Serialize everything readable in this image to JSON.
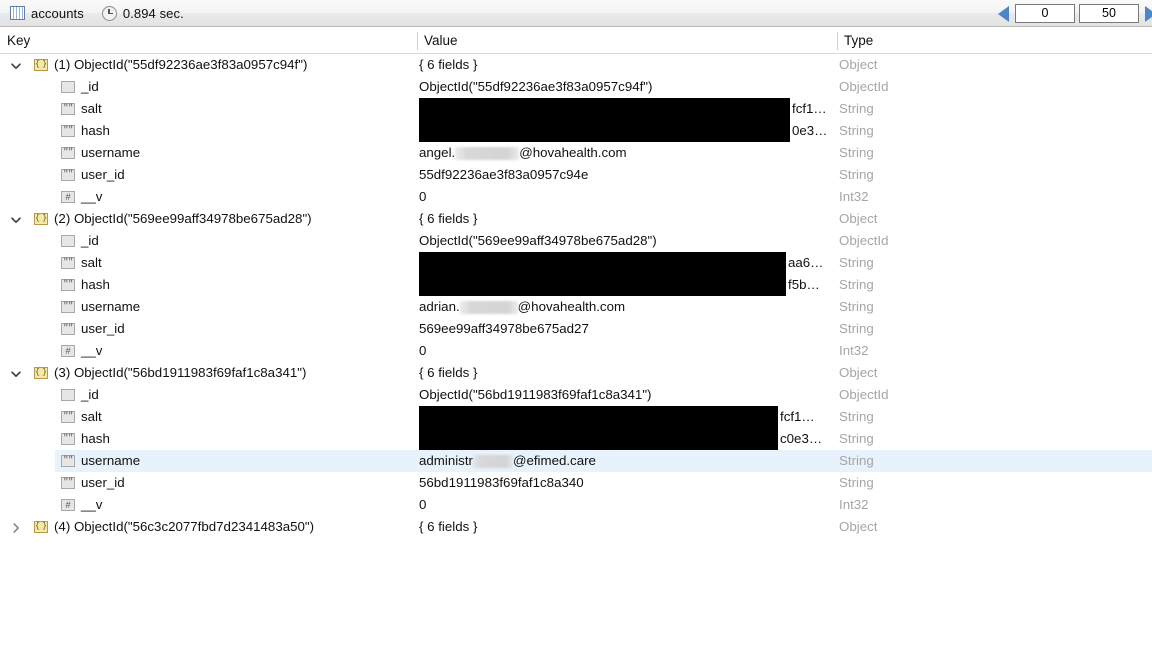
{
  "toolbar": {
    "collection_icon": "grid-icon",
    "collection_name": "accounts",
    "timer_icon": "clock-icon",
    "query_time": "0.894 sec.",
    "prev_icon": "left-arrow-icon",
    "next_icon": "right-arrow-icon",
    "skip_value": "0",
    "limit_value": "50"
  },
  "columns": {
    "key": "Key",
    "value": "Value",
    "type": "Type"
  },
  "rows": [
    {
      "indent": 0,
      "twisty": "expanded",
      "icon": "object-icon",
      "key": "(1) ObjectId(\"55df92236ae3f83a0957c94f\")",
      "value": "{ 6 fields }",
      "type": "Object"
    },
    {
      "indent": 1,
      "twisty": "none",
      "icon": "objectid-icon",
      "key": "_id",
      "value": "ObjectId(\"55df92236ae3f83a0957c94f\")",
      "type": "ObjectId"
    },
    {
      "indent": 1,
      "twisty": "none",
      "icon": "string-icon",
      "key": "salt",
      "value": "",
      "redacted": "black",
      "redact_width": 371,
      "value_tail": "fcf1…",
      "type": "String"
    },
    {
      "indent": 1,
      "twisty": "none",
      "icon": "string-icon",
      "key": "hash",
      "value": "",
      "redacted": "black",
      "redact_width": 371,
      "value_tail": "0e3…",
      "type": "String"
    },
    {
      "indent": 1,
      "twisty": "none",
      "icon": "string-icon",
      "key": "username",
      "value_prefix": "angel.",
      "redacted": "blur",
      "redact_width": 64,
      "value_suffix": "@hovahealth.com",
      "type": "String"
    },
    {
      "indent": 1,
      "twisty": "none",
      "icon": "string-icon",
      "key": "user_id",
      "value": "55df92236ae3f83a0957c94e",
      "type": "String"
    },
    {
      "indent": 1,
      "twisty": "none",
      "icon": "int-icon",
      "key": "__v",
      "value": "0",
      "type": "Int32"
    },
    {
      "indent": 0,
      "twisty": "expanded",
      "icon": "object-icon",
      "key": "(2) ObjectId(\"569ee99aff34978be675ad28\")",
      "value": "{ 6 fields }",
      "type": "Object"
    },
    {
      "indent": 1,
      "twisty": "none",
      "icon": "objectid-icon",
      "key": "_id",
      "value": "ObjectId(\"569ee99aff34978be675ad28\")",
      "type": "ObjectId"
    },
    {
      "indent": 1,
      "twisty": "none",
      "icon": "string-icon",
      "key": "salt",
      "value": "",
      "redacted": "black",
      "redact_width": 367,
      "value_tail": "aa6…",
      "type": "String"
    },
    {
      "indent": 1,
      "twisty": "none",
      "icon": "string-icon",
      "key": "hash",
      "value": "",
      "redacted": "black",
      "redact_width": 367,
      "value_tail": "f5b…",
      "type": "String"
    },
    {
      "indent": 1,
      "twisty": "none",
      "icon": "string-icon",
      "key": "username",
      "value_prefix": "adrian.",
      "redacted": "blur",
      "redact_width": 58,
      "value_suffix": "@hovahealth.com",
      "type": "String"
    },
    {
      "indent": 1,
      "twisty": "none",
      "icon": "string-icon",
      "key": "user_id",
      "value": "569ee99aff34978be675ad27",
      "type": "String"
    },
    {
      "indent": 1,
      "twisty": "none",
      "icon": "int-icon",
      "key": "__v",
      "value": "0",
      "type": "Int32"
    },
    {
      "indent": 0,
      "twisty": "expanded",
      "icon": "object-icon",
      "key": "(3) ObjectId(\"56bd1911983f69faf1c8a341\")",
      "value": "{ 6 fields }",
      "type": "Object"
    },
    {
      "indent": 1,
      "twisty": "none",
      "icon": "objectid-icon",
      "key": "_id",
      "value": "ObjectId(\"56bd1911983f69faf1c8a341\")",
      "type": "ObjectId"
    },
    {
      "indent": 1,
      "twisty": "none",
      "icon": "string-icon",
      "key": "salt",
      "value": "",
      "redacted": "black",
      "redact_width": 359,
      "value_tail": "fcf1…",
      "type": "String"
    },
    {
      "indent": 1,
      "twisty": "none",
      "icon": "string-icon",
      "key": "hash",
      "value": "",
      "redacted": "black",
      "redact_width": 359,
      "value_tail": "c0e3…",
      "type": "String"
    },
    {
      "indent": 1,
      "twisty": "none",
      "icon": "string-icon",
      "key": "username",
      "value_prefix": "administr",
      "redacted": "blur",
      "redact_width": 40,
      "value_suffix": "@efimed.care",
      "type": "String",
      "selected": true
    },
    {
      "indent": 1,
      "twisty": "none",
      "icon": "string-icon",
      "key": "user_id",
      "value": "56bd1911983f69faf1c8a340",
      "type": "String"
    },
    {
      "indent": 1,
      "twisty": "none",
      "icon": "int-icon",
      "key": "__v",
      "value": "0",
      "type": "Int32"
    },
    {
      "indent": 0,
      "twisty": "collapsed",
      "icon": "object-icon",
      "key": "(4) ObjectId(\"56c3c2077fbd7d2341483a50\")",
      "value": "{ 6 fields }",
      "type": "Object"
    }
  ],
  "colors": {
    "selection": "#e8f2fc",
    "type_text": "#a6a6a6",
    "accent_arrow": "#4a86c8",
    "object_icon": "#f6e8a8"
  }
}
